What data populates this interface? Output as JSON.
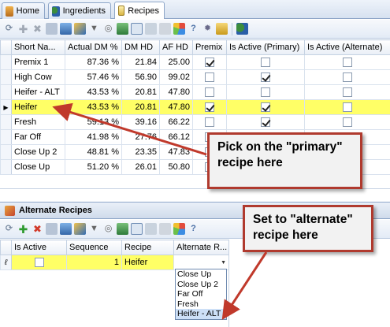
{
  "tabs": [
    {
      "label": "Home",
      "icon": "home-icon"
    },
    {
      "label": "Ingredients",
      "icon": "ingredients-icon"
    },
    {
      "label": "Recipes",
      "icon": "recipes-icon"
    }
  ],
  "recipes_grid": {
    "columns": [
      "Short Na...",
      "Actual DM %",
      "DM HD",
      "AF HD",
      "Premix",
      "Is Active (Primary)",
      "Is Active (Alternate)"
    ],
    "rows": [
      {
        "name": "Premix 1",
        "dm": "87.36 %",
        "dmhd": "21.84",
        "afhd": "25.00",
        "premix": true,
        "primary": false,
        "alternate": false
      },
      {
        "name": "High Cow",
        "dm": "57.46 %",
        "dmhd": "56.90",
        "afhd": "99.02",
        "premix": false,
        "primary": true,
        "alternate": false
      },
      {
        "name": "Heifer - ALT",
        "dm": "43.53 %",
        "dmhd": "20.81",
        "afhd": "47.80",
        "premix": false,
        "primary": false,
        "alternate": false
      },
      {
        "name": "Heifer",
        "dm": "43.53 %",
        "dmhd": "20.81",
        "afhd": "47.80",
        "premix": true,
        "primary": true,
        "alternate": false,
        "selected": true
      },
      {
        "name": "Fresh",
        "dm": "59.13 %",
        "dmhd": "39.16",
        "afhd": "66.22",
        "premix": false,
        "primary": true,
        "alternate": false
      },
      {
        "name": "Far Off",
        "dm": "41.98 %",
        "dmhd": "27.76",
        "afhd": "66.12",
        "premix": false,
        "primary": false,
        "alternate": false
      },
      {
        "name": "Close Up 2",
        "dm": "48.81 %",
        "dmhd": "23.35",
        "afhd": "47.83",
        "premix": false,
        "primary": false,
        "alternate": false
      },
      {
        "name": "Close Up",
        "dm": "51.20 %",
        "dmhd": "26.01",
        "afhd": "50.80",
        "premix": false,
        "primary": false,
        "alternate": false
      }
    ]
  },
  "alternate_panel": {
    "title": "Alternate Recipes",
    "columns": [
      "Is Active",
      "Sequence",
      "Recipe",
      "Alternate R..."
    ],
    "row": {
      "active": false,
      "sequence": "1",
      "recipe": "Heifer",
      "alternate": ""
    },
    "dropdown_options": [
      "Close Up",
      "Close Up 2",
      "Far Off",
      "Fresh",
      "Heifer - ALT"
    ],
    "dropdown_highlight": "Heifer - ALT"
  },
  "callouts": {
    "primary": "Pick on the \"primary\" recipe here",
    "alternate": "Set to \"alternate\" recipe here"
  },
  "colors": {
    "selected_row": "#ffff66",
    "callout_border": "#b03a2e",
    "arrow": "#c0392b"
  }
}
